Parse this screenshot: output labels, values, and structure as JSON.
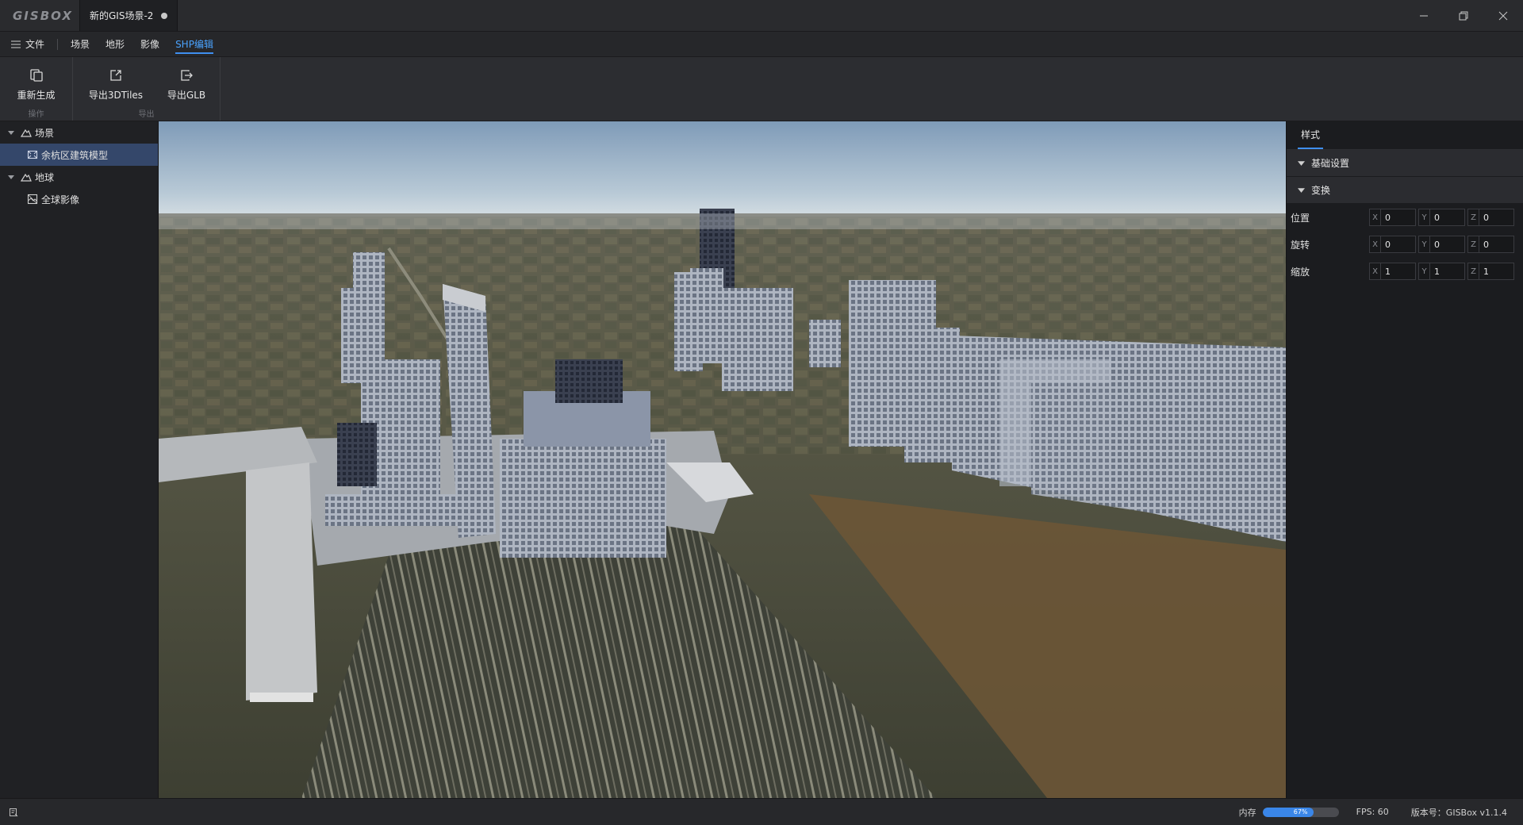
{
  "app": {
    "logo": "GISBOX",
    "doc_tab": "新的GIS场景-2"
  },
  "menu": {
    "file": "文件",
    "items": [
      "场景",
      "地形",
      "影像",
      "SHP编辑"
    ],
    "active_index": 3
  },
  "ribbon": {
    "groups": [
      {
        "label": "操作",
        "buttons": [
          {
            "label": "重新生成",
            "icon": "regenerate-icon"
          }
        ]
      },
      {
        "label": "导出",
        "buttons": [
          {
            "label": "导出3DTiles",
            "icon": "export-icon"
          },
          {
            "label": "导出GLB",
            "icon": "export-glb-icon"
          }
        ]
      }
    ]
  },
  "tree": {
    "scene": {
      "label": "场景",
      "child": "余杭区建筑模型"
    },
    "globe": {
      "label": "地球",
      "child": "全球影像"
    }
  },
  "props": {
    "tab": "样式",
    "section_basic": "基础设置",
    "section_transform": "变换",
    "rows": [
      {
        "label": "位置",
        "x": "0",
        "y": "0",
        "z": "0"
      },
      {
        "label": "旋转",
        "x": "0",
        "y": "0",
        "z": "0"
      },
      {
        "label": "缩放",
        "x": "1",
        "y": "1",
        "z": "1"
      }
    ],
    "axis": {
      "x": "X",
      "y": "Y",
      "z": "Z"
    }
  },
  "status": {
    "memory_label": "内存",
    "memory_percent": 67,
    "memory_text": "67%",
    "fps": "FPS: 60",
    "version": "版本号：GISBox v1.1.4"
  },
  "colors": {
    "accent": "#3f8ff0",
    "selected_bg": "#34476a"
  }
}
